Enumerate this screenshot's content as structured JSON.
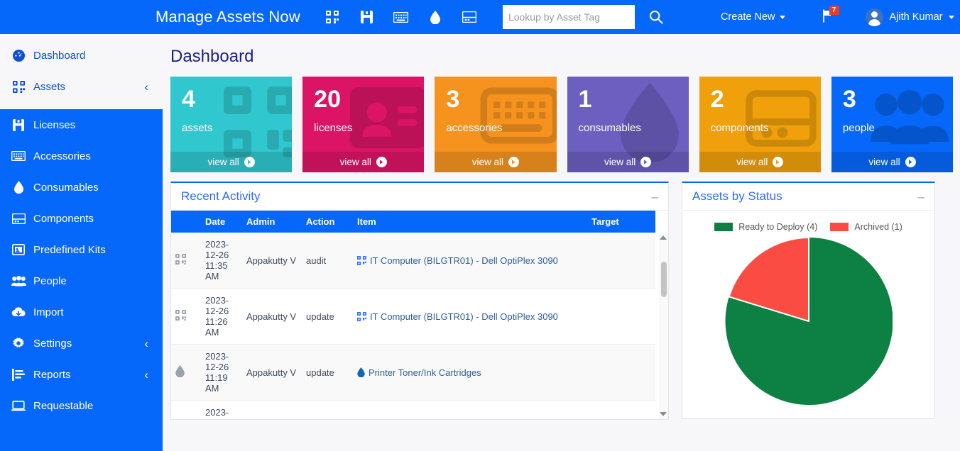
{
  "topbar": {
    "brand": "Manage Assets Now",
    "menu_icon": "hamburger-icon",
    "nav_icons": [
      "assets-qr-icon",
      "licenses-save-icon",
      "accessories-keyboard-icon",
      "consumables-droplet-icon",
      "components-card-icon"
    ],
    "search": {
      "placeholder": "Lookup by Asset Tag",
      "value": ""
    },
    "search_button": "search-icon",
    "create_new": "Create New",
    "notifications_count": "7",
    "user_name": "Ajith Kumar",
    "settings_icon": "gear-icon"
  },
  "sidebar": {
    "items": [
      {
        "label": "Dashboard",
        "icon": "dashboard-icon",
        "chevron": "",
        "active": true
      },
      {
        "label": "Assets",
        "icon": "assets-qr-icon",
        "chevron": "‹",
        "active": true
      },
      {
        "label": "Licenses",
        "icon": "licenses-save-icon",
        "chevron": ""
      },
      {
        "label": "Accessories",
        "icon": "keyboard-icon",
        "chevron": ""
      },
      {
        "label": "Consumables",
        "icon": "droplet-icon",
        "chevron": ""
      },
      {
        "label": "Components",
        "icon": "card-icon",
        "chevron": ""
      },
      {
        "label": "Predefined Kits",
        "icon": "kit-icon",
        "chevron": ""
      },
      {
        "label": "People",
        "icon": "people-icon",
        "chevron": ""
      },
      {
        "label": "Import",
        "icon": "cloud-download-icon",
        "chevron": ""
      },
      {
        "label": "Settings",
        "icon": "gear-icon",
        "chevron": "‹"
      },
      {
        "label": "Reports",
        "icon": "chart-icon",
        "chevron": "‹"
      },
      {
        "label": "Requestable",
        "icon": "laptop-icon",
        "chevron": ""
      }
    ]
  },
  "main": {
    "page_title": "Dashboard",
    "cards": [
      {
        "count": "4",
        "label": "assets",
        "action": "view all",
        "color": "#30c7ce",
        "icon": "qr-icon"
      },
      {
        "count": "20",
        "label": "licenses",
        "action": "view all",
        "color": "#db1466",
        "icon": "id-card-icon"
      },
      {
        "count": "3",
        "label": "accessories",
        "action": "view all",
        "color": "#f5931e",
        "icon": "keyboard-icon"
      },
      {
        "count": "1",
        "label": "consumables",
        "action": "view all",
        "color": "#6c5fc0",
        "icon": "droplet-icon"
      },
      {
        "count": "2",
        "label": "components",
        "action": "view all",
        "color": "#efa00b",
        "icon": "component-icon"
      },
      {
        "count": "3",
        "label": "people",
        "action": "view all",
        "color": "#0668fa",
        "icon": "people-icon"
      }
    ],
    "recent_activity": {
      "title": "Recent Activity",
      "collapse": "–",
      "columns": [
        "",
        "Date",
        "Admin",
        "Action",
        "Item",
        "Target"
      ],
      "rows": [
        {
          "icon": "qr-icon",
          "date": "2023-12-26 11:35 AM",
          "admin": "Appakutty V",
          "action": "audit",
          "item_icon": "qr-icon",
          "item": "IT Computer (BILGTR01) - Dell OptiPlex 3090",
          "target": ""
        },
        {
          "icon": "qr-icon",
          "date": "2023-12-26 11:26 AM",
          "admin": "Appakutty V",
          "action": "update",
          "item_icon": "qr-icon",
          "item": "IT Computer (BILGTR01) - Dell OptiPlex 3090",
          "target": ""
        },
        {
          "icon": "droplet-icon",
          "date": "2023-12-26 11:19 AM",
          "admin": "Appakutty V",
          "action": "update",
          "item_icon": "droplet-icon",
          "item": "Printer Toner/Ink Cartridges",
          "target": ""
        },
        {
          "icon": "",
          "date": "2023-",
          "admin": "",
          "action": "",
          "item_icon": "",
          "item": "",
          "target": ""
        }
      ]
    },
    "assets_by_status": {
      "title": "Assets by Status",
      "collapse": "–"
    }
  },
  "chart_data": {
    "type": "pie",
    "title": "Assets by Status",
    "legend_position": "top",
    "labels": [
      "Ready to Deploy",
      "Archived"
    ],
    "legend_entries": [
      "Ready to Deploy (4)",
      "Archived (1)"
    ],
    "values": [
      4,
      1
    ],
    "percentages": [
      80,
      20
    ],
    "colors": [
      "#0d8043",
      "#fb4c44"
    ],
    "start_angle_deg": 0,
    "direction": "counter-clockwise"
  }
}
